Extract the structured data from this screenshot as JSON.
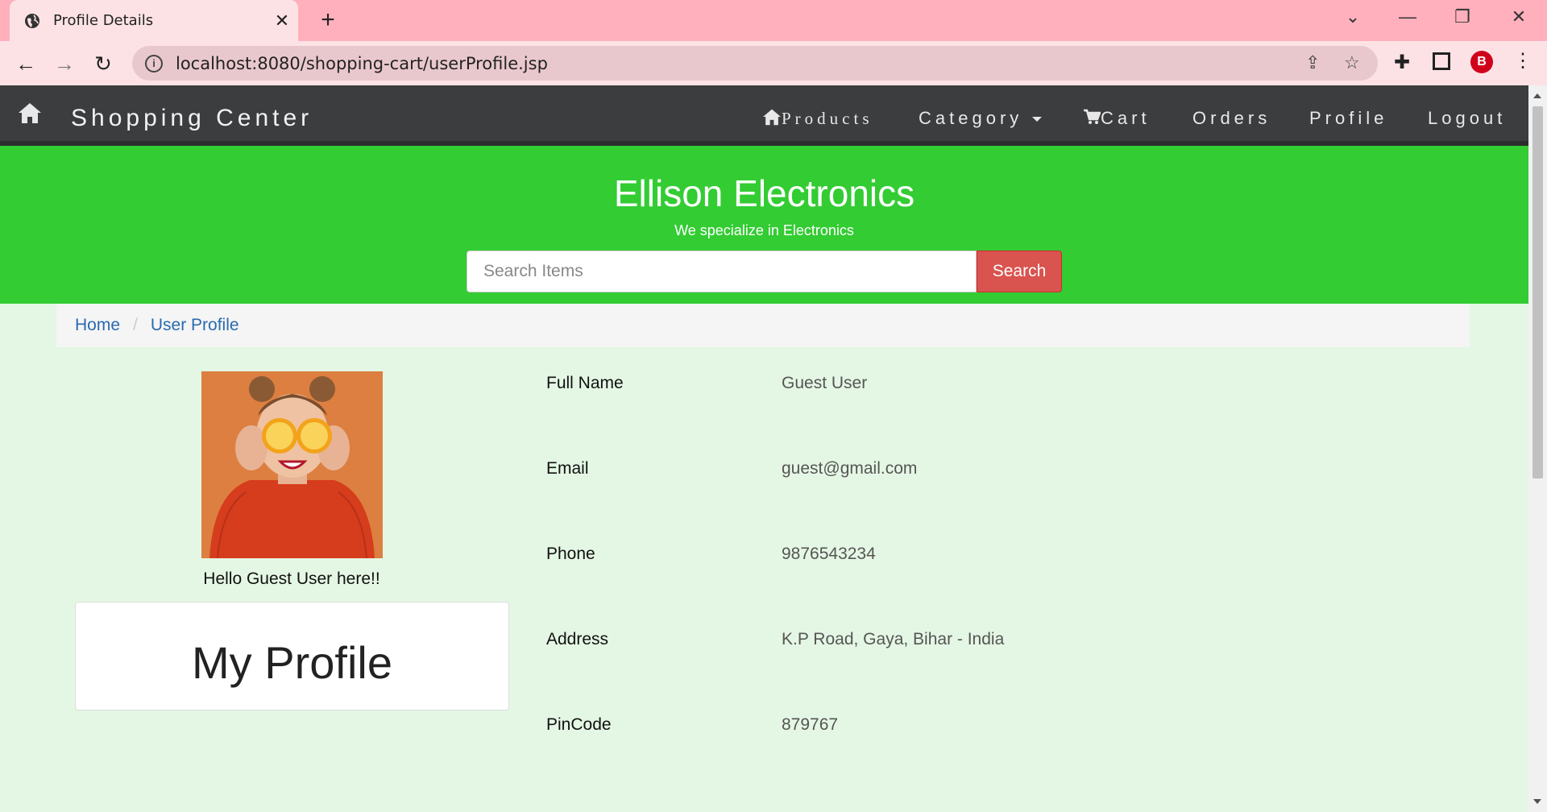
{
  "browser": {
    "tab_title": "Profile Details",
    "url": "localhost:8080/shopping-cart/userProfile.jsp"
  },
  "navbar": {
    "brand": "Shopping Center",
    "items": [
      "Products",
      "Category",
      "Cart",
      "Orders",
      "Profile",
      "Logout"
    ]
  },
  "hero": {
    "title": "Ellison Electronics",
    "tagline": "We specialize in Electronics",
    "search_placeholder": "Search Items",
    "search_button": "Search"
  },
  "breadcrumb": [
    "Home",
    "User Profile"
  ],
  "profile": {
    "greeting": "Hello Guest User here!!",
    "card_title": "My Profile",
    "fields": [
      {
        "label": "Full Name",
        "value": "Guest User"
      },
      {
        "label": "Email",
        "value": "guest@gmail.com"
      },
      {
        "label": "Phone",
        "value": "9876543234"
      },
      {
        "label": "Address",
        "value": "K.P Road, Gaya, Bihar - India"
      },
      {
        "label": "PinCode",
        "value": "879767"
      }
    ]
  },
  "colors": {
    "navbar": "#3c3d3f",
    "hero": "#33cc33",
    "search_button": "#d9534f",
    "page_bg": "#e4f7e4",
    "browser_frame": "#ffb0bc"
  }
}
